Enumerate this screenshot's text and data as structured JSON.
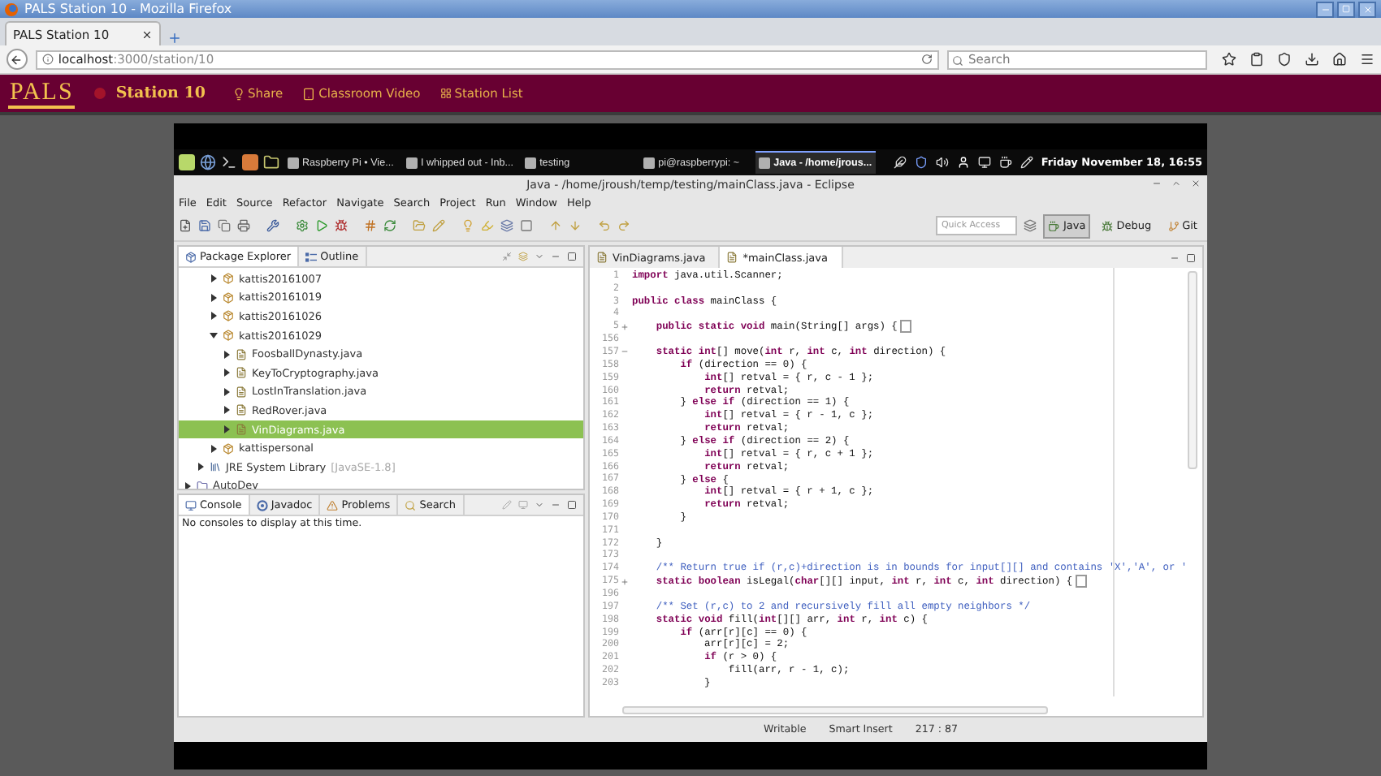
{
  "browser": {
    "title": "PALS Station 10 - Mozilla Firefox",
    "tab": "PALS Station 10",
    "url_host": "localhost",
    "url_path": ":3000/station/10",
    "search_placeholder": "Search"
  },
  "site_header": {
    "logo": "PALS",
    "title": "Station 10",
    "nav": [
      "Share",
      "Classroom Video",
      "Station List"
    ]
  },
  "taskbar": {
    "tasks": [
      {
        "label": "Raspberry Pi • Vie...",
        "selected": false
      },
      {
        "label": "I whipped out - Inb...",
        "selected": false
      },
      {
        "label": "testing",
        "selected": false
      },
      {
        "label": "pi@raspberrypi: ~",
        "selected": false
      },
      {
        "label": "Java - /home/jrous...",
        "selected": true
      }
    ],
    "clock": "Friday November 18, 16:55"
  },
  "eclipse": {
    "title": "Java - /home/jroush/temp/testing/mainClass.java - Eclipse",
    "menu": [
      "File",
      "Edit",
      "Source",
      "Refactor",
      "Navigate",
      "Search",
      "Project",
      "Run",
      "Window",
      "Help"
    ],
    "quick_access_placeholder": "Quick Access",
    "perspectives": [
      {
        "label": "Java",
        "selected": true
      },
      {
        "label": "Debug",
        "selected": false
      },
      {
        "label": "Git",
        "selected": false
      }
    ],
    "explorer_tabs": [
      {
        "label": "Package Explorer",
        "selected": true
      },
      {
        "label": "Outline",
        "selected": false
      }
    ],
    "tree": [
      {
        "children": [
          {
            "children": [
              {
                "label": "kattis20161007",
                "kind": "package",
                "expanded": false,
                "selected": false
              },
              {
                "label": "kattis20161019",
                "kind": "package",
                "expanded": false,
                "selected": false
              },
              {
                "label": "kattis20161026",
                "kind": "package",
                "expanded": false,
                "selected": false
              },
              {
                "label": "kattis20161029",
                "kind": "package",
                "expanded": true,
                "selected": false,
                "children": [
                  {
                    "label": "FoosballDynasty.java",
                    "kind": "file",
                    "expanded": false,
                    "selected": false
                  },
                  {
                    "label": "KeyToCryptography.java",
                    "kind": "file",
                    "expanded": false,
                    "selected": false
                  },
                  {
                    "label": "LostInTranslation.java",
                    "kind": "file",
                    "expanded": false,
                    "selected": false
                  },
                  {
                    "label": "RedRover.java",
                    "kind": "file",
                    "expanded": false,
                    "selected": false
                  },
                  {
                    "label": "VinDiagrams.java",
                    "kind": "file",
                    "expanded": false,
                    "selected": true
                  }
                ]
              },
              {
                "label": "kattispersonal",
                "kind": "package",
                "expanded": false,
                "selected": false
              }
            ]
          },
          {
            "label": "JRE System Library",
            "decoration": "[JavaSE-1.8]",
            "kind": "library",
            "expanded": false,
            "selected": false
          }
        ]
      },
      {
        "label": "AutoDev",
        "kind": "project",
        "expanded": false,
        "selected": false
      }
    ],
    "console_tabs": [
      {
        "label": "Console",
        "selected": true
      },
      {
        "label": "Javadoc",
        "selected": false
      },
      {
        "label": "Problems",
        "selected": false
      },
      {
        "label": "Search",
        "selected": false
      }
    ],
    "console_message": "No consoles to display at this time.",
    "editor_tabs": [
      {
        "label": "VinDiagrams.java",
        "selected": false
      },
      {
        "label": "*mainClass.java",
        "selected": true
      }
    ],
    "code": [
      {
        "number": "1",
        "kind": "code",
        "text": "**import** java.util.Scanner;"
      },
      {
        "number": "2"
      },
      {
        "number": "3",
        "kind": "code",
        "text": "**public class** mainClass {"
      },
      {
        "number": "4"
      },
      {
        "number": "5",
        "kind": "code",
        "folded": true,
        "text": "    **public static void** main(String[] args) {"
      },
      {
        "number": "156"
      },
      {
        "number": "157",
        "kind": "code",
        "folded": false,
        "text": "    **static int**[] move(**int** r, **int** c, **int** direction) {"
      },
      {
        "number": "158",
        "kind": "code",
        "text": "        **if** (direction == 0) {"
      },
      {
        "number": "159",
        "kind": "code",
        "text": "            **int**[] retval = { r, c - 1 };"
      },
      {
        "number": "160",
        "kind": "code",
        "text": "            **return** retval;"
      },
      {
        "number": "161",
        "kind": "code",
        "text": "        } **else if** (direction == 1) {"
      },
      {
        "number": "162",
        "kind": "code",
        "text": "            **int**[] retval = { r - 1, c };"
      },
      {
        "number": "163",
        "kind": "code",
        "text": "            **return** retval;"
      },
      {
        "number": "164",
        "kind": "code",
        "text": "        } **else if** (direction == 2) {"
      },
      {
        "number": "165",
        "kind": "code",
        "text": "            **int**[] retval = { r, c + 1 };"
      },
      {
        "number": "166",
        "kind": "code",
        "text": "            **return** retval;"
      },
      {
        "number": "167",
        "kind": "code",
        "text": "        } **else** {"
      },
      {
        "number": "168",
        "kind": "code",
        "text": "            **int**[] retval = { r + 1, c };"
      },
      {
        "number": "169",
        "kind": "code",
        "text": "            **return** retval;"
      },
      {
        "number": "170",
        "kind": "code",
        "text": "        }"
      },
      {
        "number": "171"
      },
      {
        "number": "172",
        "kind": "code",
        "text": "    }"
      },
      {
        "number": "173"
      },
      {
        "number": "174",
        "kind": "comment",
        "text": "    /** Return true if (r,c)+direction is in bounds for input[][] and contains 'X','A', or '"
      },
      {
        "number": "175",
        "kind": "code",
        "folded": true,
        "text": "    **static boolean** isLegal(**char**[][] input, **int** r, **int** c, **int** direction) {"
      },
      {
        "number": "196"
      },
      {
        "number": "197",
        "kind": "comment",
        "text": "    /** Set (r,c) to 2 and recursively fill all empty neighbors */"
      },
      {
        "number": "198",
        "kind": "code",
        "text": "    **static void** fill(**int**[][] arr, **int** r, **int** c) {"
      },
      {
        "number": "199",
        "kind": "code",
        "text": "        **if** (arr[r][c] == 0) {"
      },
      {
        "number": "200",
        "kind": "code",
        "text": "            arr[r][c] = 2;"
      },
      {
        "number": "201",
        "kind": "code",
        "text": "            **if** (r > 0) {"
      },
      {
        "number": "202",
        "kind": "code",
        "text": "                fill(arr, r - 1, c);"
      },
      {
        "number": "203",
        "kind": "code",
        "text": "            }"
      }
    ],
    "status": [
      "Writable",
      "Smart Insert",
      "217 : 87"
    ]
  }
}
